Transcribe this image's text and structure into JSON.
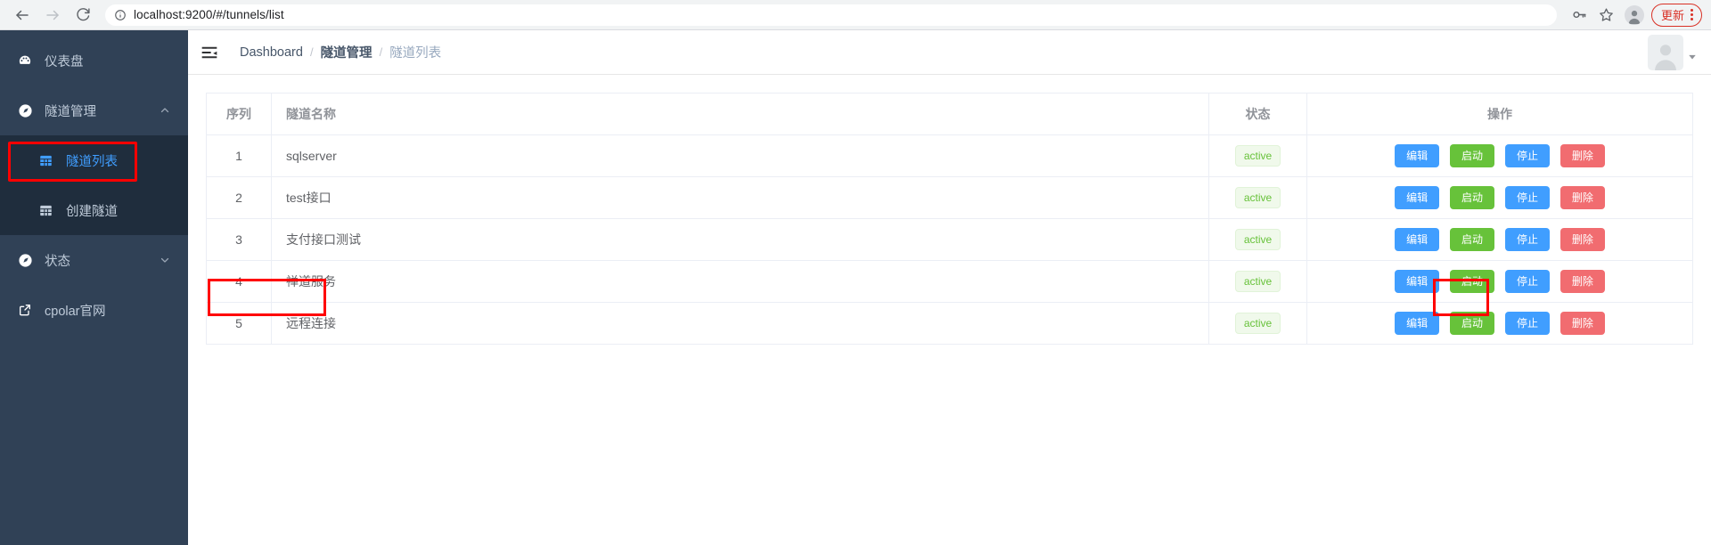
{
  "browser": {
    "back_label": "back",
    "forward_label": "forward",
    "reload_label": "reload",
    "url_scheme": "",
    "url": "localhost:9200/#/tunnels/list",
    "update_button_label": "更新",
    "icons": {
      "info": "info-icon",
      "password_key": "key-icon",
      "bookmark": "star-icon",
      "profile": "profile-avatar-icon",
      "menu": "three-dot-menu-icon"
    }
  },
  "sidebar": {
    "items": [
      {
        "label": "仪表盘",
        "icon": "dashboard-icon",
        "has_caret": false,
        "active": false
      },
      {
        "label": "隧道管理",
        "icon": "compass-icon",
        "has_caret": true,
        "caret": "▲",
        "active": false
      },
      {
        "label": "状态",
        "icon": "compass-icon",
        "has_caret": true,
        "caret": "▼",
        "active": false
      },
      {
        "label": "cpolar官网",
        "icon": "external-link-icon",
        "has_caret": false,
        "active": false
      }
    ],
    "submenu": [
      {
        "label": "隧道列表",
        "icon": "grid-icon",
        "active": true
      },
      {
        "label": "创建隧道",
        "icon": "grid-icon",
        "active": false
      }
    ]
  },
  "navbar": {
    "hamburger_icon": "collapse-menu-icon",
    "breadcrumb": [
      {
        "label": "Dashboard",
        "style": "normal"
      },
      {
        "label": "隧道管理",
        "style": "bold"
      },
      {
        "label": "隧道列表",
        "style": "muted"
      }
    ],
    "separator": "/",
    "avatar_icon": "user-avatar-icon",
    "caret": "▼"
  },
  "table": {
    "headers": {
      "index": "序列",
      "name": "隧道名称",
      "status": "状态",
      "operations": "操作"
    },
    "rows": [
      {
        "index": "1",
        "name": "sqlserver",
        "status": "active"
      },
      {
        "index": "2",
        "name": "test接口",
        "status": "active"
      },
      {
        "index": "3",
        "name": "支付接口测试",
        "status": "active"
      },
      {
        "index": "4",
        "name": "禅道服务",
        "status": "active"
      },
      {
        "index": "5",
        "name": "远程连接",
        "status": "active"
      }
    ],
    "buttons": {
      "edit": "编辑",
      "start": "启动",
      "stop": "停止",
      "delete": "删除"
    }
  },
  "colors": {
    "sidebar_bg": "#304156",
    "submenu_bg": "#1f2d3d",
    "accent_blue": "#409eff",
    "success_green": "#67c23a",
    "danger_red": "#f16c70",
    "highlight_red": "#ff0000"
  }
}
